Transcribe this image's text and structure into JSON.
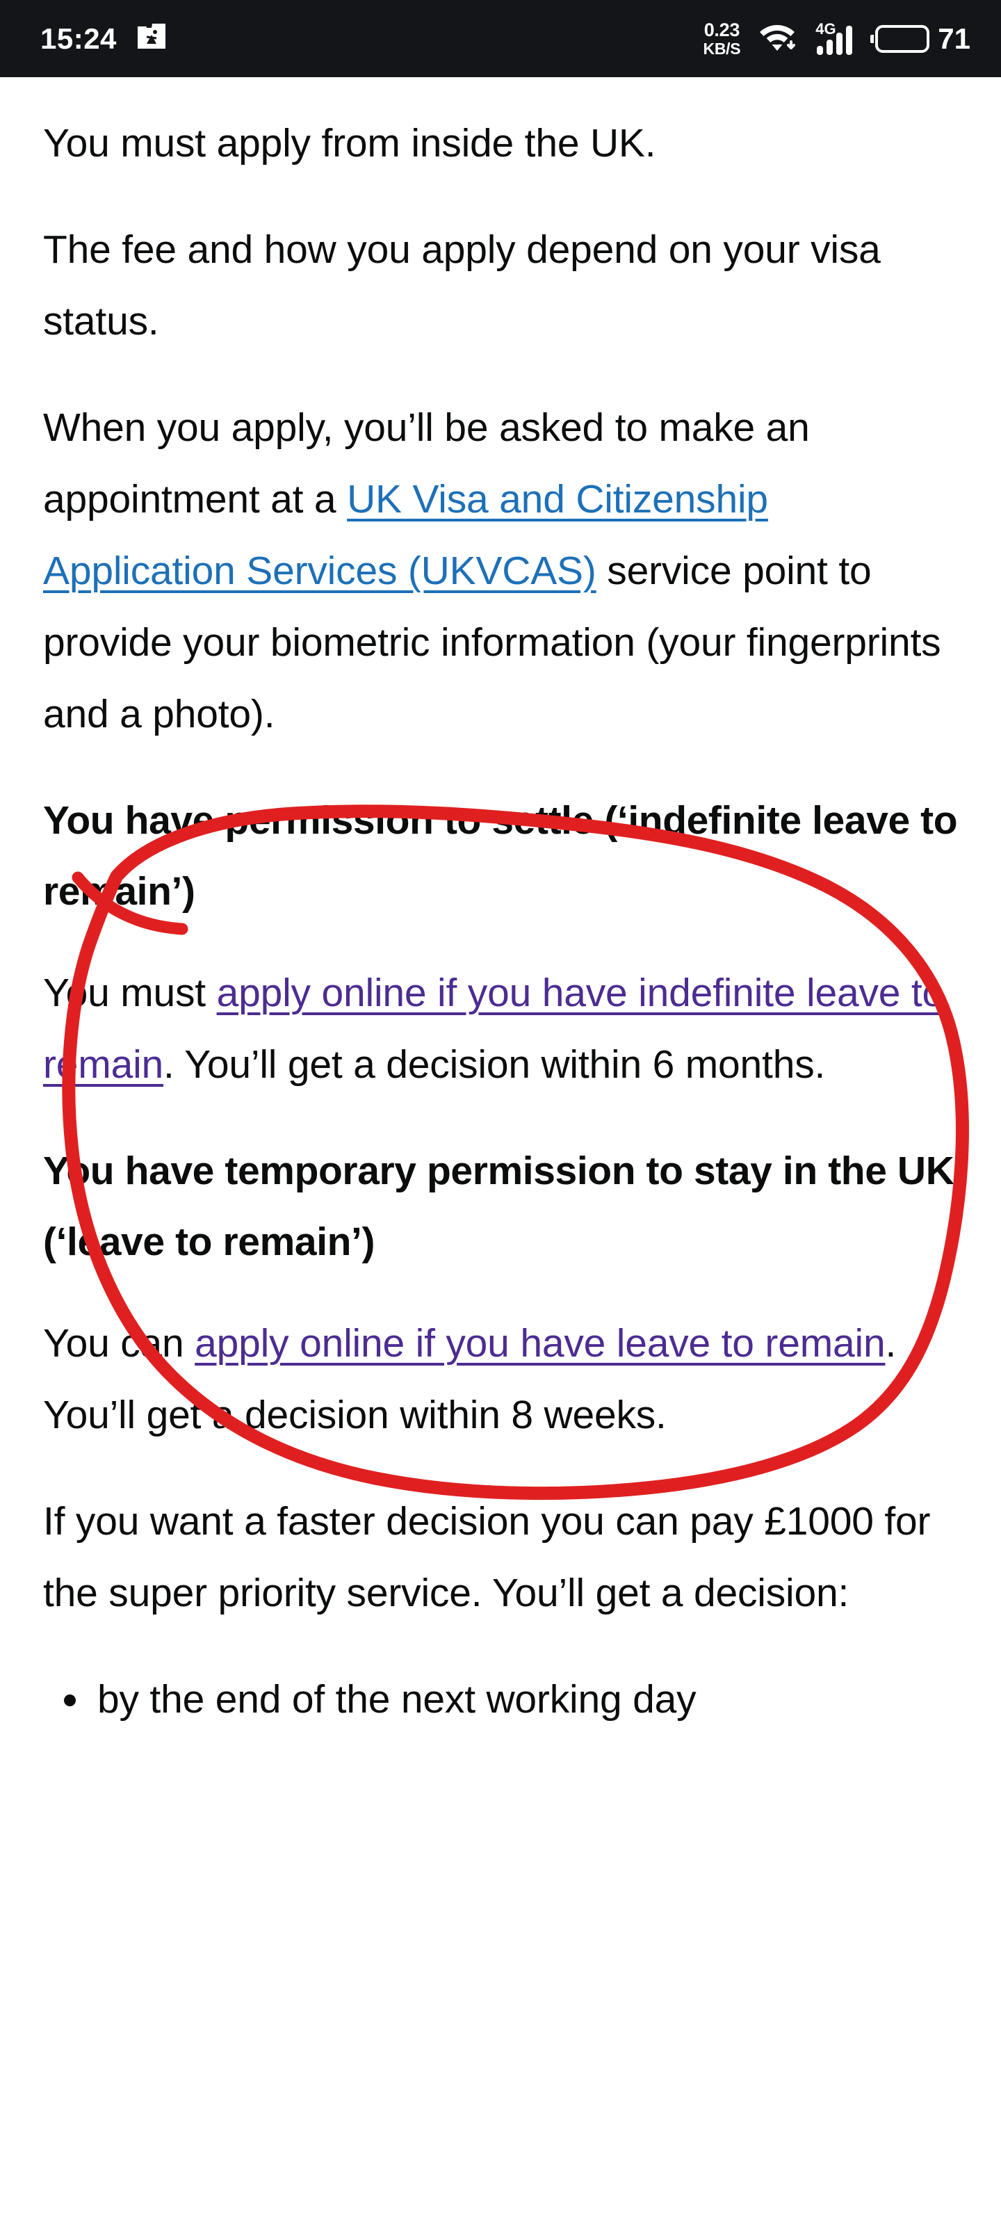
{
  "status_bar": {
    "clock": "15:24",
    "screenshot_icon": "screenshot-gallery-icon",
    "network_speed_value": "0.23",
    "network_speed_unit": "KB/S",
    "wifi_icon": "wifi-icon",
    "mobile_network_label": "4G",
    "signal_icon": "signal-bars-icon",
    "battery_icon": "battery-icon",
    "battery_percent": "71",
    "background_color": "#131519",
    "foreground_color": "#ffffff"
  },
  "page": {
    "background_color": "#ffffff",
    "text_color": "#0b0c0c",
    "link_color": "#1d70b8",
    "visited_link_color": "#4c2c92",
    "annotation_color": "#e02020"
  },
  "body": {
    "p1": "You must apply from inside the UK.",
    "p2": "The fee and how you apply depend on your visa status.",
    "p3_before_link": "When you apply, you’ll be asked to make an appointment at a ",
    "p3_link": "UK Visa and Citizenship Application Services (UKVCAS)",
    "p3_after_link": " service point to provide your biometric information (your fingerprints and a photo).",
    "h1": "You have permission to settle (‘indefinite leave to remain’)",
    "p4_before_link": "You must ",
    "p4_link": "apply online if you have indefinite leave to remain",
    "p4_after_link": ". You’ll get a decision within 6 months.",
    "h2": "You have temporary permission to stay in the UK (‘leave to remain’)",
    "p5_before_link": "You can ",
    "p5_link": "apply online if you have leave to remain",
    "p5_after_link": ". You’ll get a decision within 8 weeks.",
    "p6": "If you want a faster decision you can pay £1000 for the super priority service. You’ll get a decision:",
    "bullet1": "by the end of the next working day"
  },
  "annotation": {
    "shape": "hand-drawn-red-circle",
    "encircles": "You have permission to settle (‘indefinite leave to remain’)"
  }
}
